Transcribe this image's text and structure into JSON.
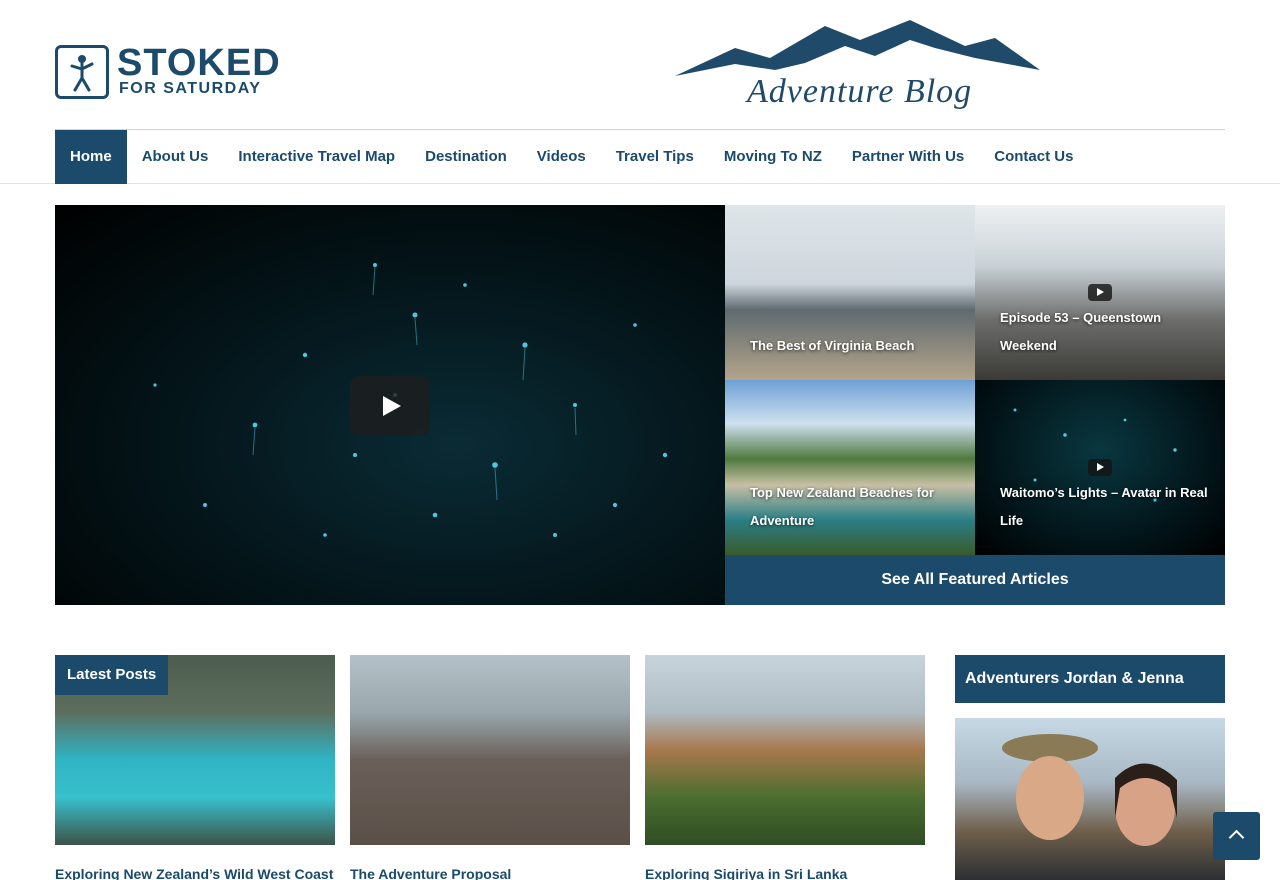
{
  "header": {
    "logo_line1": "STOKED",
    "logo_line2": "FOR SATURDAY",
    "banner_text": "Adventure Blog"
  },
  "nav": {
    "items": [
      {
        "label": "Home",
        "active": true
      },
      {
        "label": "About Us"
      },
      {
        "label": "Interactive Travel Map"
      },
      {
        "label": "Destination"
      },
      {
        "label": "Videos"
      },
      {
        "label": "Travel Tips"
      },
      {
        "label": "Moving To NZ"
      },
      {
        "label": "Partner With Us"
      },
      {
        "label": "Contact Us"
      }
    ]
  },
  "featured": {
    "tiles": [
      {
        "title": "The Best of Virginia Beach",
        "video": false
      },
      {
        "title": "Episode 53 – Queenstown Weekend",
        "video": true
      },
      {
        "title": "Top New Zealand Beaches for Adventure",
        "video": false
      },
      {
        "title": "Waitomo’s Lights – Avatar in Real Life",
        "video": true
      }
    ],
    "see_all_label": "See All Featured Articles"
  },
  "latest": {
    "badge": "Latest Posts",
    "posts": [
      {
        "title": "Exploring New Zealand’s Wild West Coast"
      },
      {
        "title": "The Adventure Proposal"
      },
      {
        "title": "Exploring Sigiriya in Sri Lanka"
      }
    ]
  },
  "sidebar": {
    "heading": "Adventurers Jordan & Jenna"
  },
  "colors": {
    "brand": "#1b4a6b"
  }
}
